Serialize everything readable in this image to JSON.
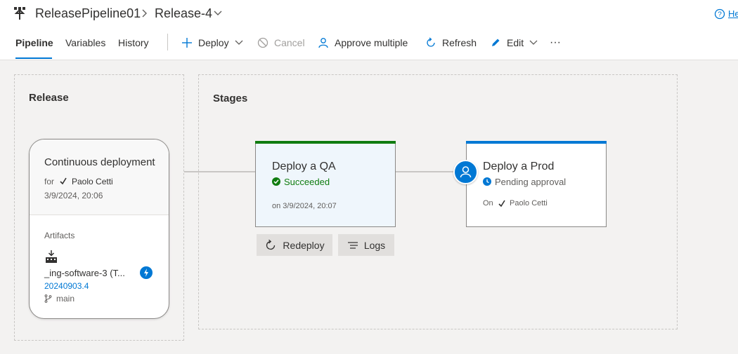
{
  "header": {
    "pipeline_name": "ReleasePipeline01",
    "release_name": "Release-4",
    "help_label": "Help"
  },
  "tabs": [
    {
      "label": "Pipeline",
      "active": true
    },
    {
      "label": "Variables",
      "active": false
    },
    {
      "label": "History",
      "active": false
    }
  ],
  "toolbar": {
    "deploy": "Deploy",
    "cancel": "Cancel",
    "approve_multiple": "Approve multiple",
    "refresh": "Refresh",
    "edit": "Edit",
    "more": "···"
  },
  "release_section": {
    "title": "Release",
    "trigger_title": "Continuous deployment",
    "for_label": "for",
    "author": "Paolo Cetti",
    "date": "3/9/2024, 20:06",
    "artifacts_label": "Artifacts",
    "artifact_name": "_ing-software-3 (T...",
    "build_number": "20240903.4",
    "branch": "main"
  },
  "stages_section": {
    "title": "Stages",
    "stages": [
      {
        "name": "Deploy a QA",
        "status": "Succeeded",
        "meta": "on 3/9/2024, 20:07",
        "color": "#107c10",
        "status_color": "#107c10"
      },
      {
        "name": "Deploy a Prod",
        "status": "Pending approval",
        "meta_prefix": "On",
        "meta_user": "Paolo Cetti",
        "color": "#0078d4",
        "status_color": "#605e5c"
      }
    ],
    "redeploy_label": "Redeploy",
    "logs_label": "Logs"
  },
  "icons": {
    "pipeline": "pipeline-icon",
    "breadcrumb_sep": "chevron-right-icon",
    "release_dropdown": "chevron-down-icon",
    "help": "help-icon",
    "deploy": "plus-icon",
    "cancel": "cancel-icon",
    "approve": "person-icon",
    "refresh": "refresh-icon",
    "edit": "pencil-icon",
    "author": "account-icon",
    "artifact": "build-icon",
    "trigger": "lightning-icon",
    "branch": "branch-icon",
    "succeeded": "check-circle-icon",
    "pending": "clock-icon",
    "redeploy": "redeploy-icon",
    "logs": "logs-icon",
    "approver": "approver-icon"
  },
  "colors": {
    "accent": "#0078d4",
    "success": "#107c10",
    "canvas": "#f3f2f1"
  }
}
